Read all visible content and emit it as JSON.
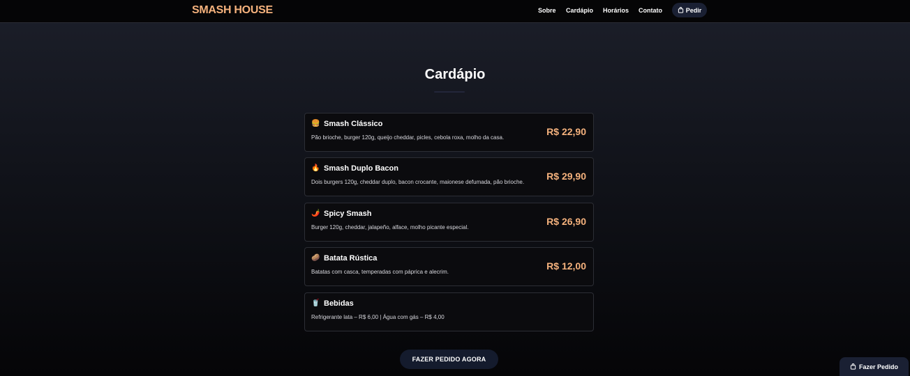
{
  "brand": "SMASH HOUSE",
  "nav": {
    "links": [
      "Sobre",
      "Cardápio",
      "Horários",
      "Contato"
    ],
    "order_label": "Pedir"
  },
  "menu": {
    "title": "Cardápio",
    "items": [
      {
        "emoji": "🍔",
        "name": "Smash Clássico",
        "desc": "Pão brioche, burger 120g, queijo cheddar, picles, cebola roxa, molho da casa.",
        "price": "R$ 22,90"
      },
      {
        "emoji": "🔥",
        "name": "Smash Duplo Bacon",
        "desc": "Dois burgers 120g, cheddar duplo, bacon crocante, maionese defumada, pão brioche.",
        "price": "R$ 29,90"
      },
      {
        "emoji": "🌶️",
        "name": "Spicy Smash",
        "desc": "Burger 120g, cheddar, jalapeño, alface, molho picante especial.",
        "price": "R$ 26,90"
      },
      {
        "emoji": "🥔",
        "name": "Batata Rústica",
        "desc": "Batatas com casca, temperadas com páprica e alecrim.",
        "price": "R$ 12,00"
      },
      {
        "emoji": "🥤",
        "name": "Bebidas",
        "desc": "Refrigerante lata – R$ 6,00 | Água com gás – R$ 4,00",
        "price": ""
      }
    ]
  },
  "cta_label": "FAZER PEDIDO AGORA",
  "floating_order_label": "Fazer Pedido",
  "colors": {
    "accent": "#f5b27d",
    "pill": "#1a2033",
    "card": "#0b0b0e"
  },
  "icons": {
    "order": "shopping-bag-icon"
  }
}
